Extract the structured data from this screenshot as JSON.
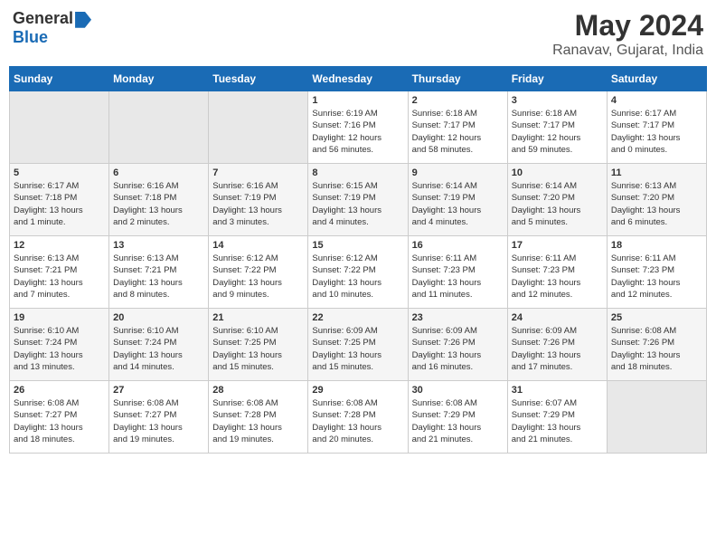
{
  "header": {
    "logo_general": "General",
    "logo_blue": "Blue",
    "month_title": "May 2024",
    "subtitle": "Ranavav, Gujarat, India"
  },
  "days_of_week": [
    "Sunday",
    "Monday",
    "Tuesday",
    "Wednesday",
    "Thursday",
    "Friday",
    "Saturday"
  ],
  "weeks": [
    [
      {
        "day": "",
        "info": ""
      },
      {
        "day": "",
        "info": ""
      },
      {
        "day": "",
        "info": ""
      },
      {
        "day": "1",
        "info": "Sunrise: 6:19 AM\nSunset: 7:16 PM\nDaylight: 12 hours\nand 56 minutes."
      },
      {
        "day": "2",
        "info": "Sunrise: 6:18 AM\nSunset: 7:17 PM\nDaylight: 12 hours\nand 58 minutes."
      },
      {
        "day": "3",
        "info": "Sunrise: 6:18 AM\nSunset: 7:17 PM\nDaylight: 12 hours\nand 59 minutes."
      },
      {
        "day": "4",
        "info": "Sunrise: 6:17 AM\nSunset: 7:17 PM\nDaylight: 13 hours\nand 0 minutes."
      }
    ],
    [
      {
        "day": "5",
        "info": "Sunrise: 6:17 AM\nSunset: 7:18 PM\nDaylight: 13 hours\nand 1 minute."
      },
      {
        "day": "6",
        "info": "Sunrise: 6:16 AM\nSunset: 7:18 PM\nDaylight: 13 hours\nand 2 minutes."
      },
      {
        "day": "7",
        "info": "Sunrise: 6:16 AM\nSunset: 7:19 PM\nDaylight: 13 hours\nand 3 minutes."
      },
      {
        "day": "8",
        "info": "Sunrise: 6:15 AM\nSunset: 7:19 PM\nDaylight: 13 hours\nand 4 minutes."
      },
      {
        "day": "9",
        "info": "Sunrise: 6:14 AM\nSunset: 7:19 PM\nDaylight: 13 hours\nand 4 minutes."
      },
      {
        "day": "10",
        "info": "Sunrise: 6:14 AM\nSunset: 7:20 PM\nDaylight: 13 hours\nand 5 minutes."
      },
      {
        "day": "11",
        "info": "Sunrise: 6:13 AM\nSunset: 7:20 PM\nDaylight: 13 hours\nand 6 minutes."
      }
    ],
    [
      {
        "day": "12",
        "info": "Sunrise: 6:13 AM\nSunset: 7:21 PM\nDaylight: 13 hours\nand 7 minutes."
      },
      {
        "day": "13",
        "info": "Sunrise: 6:13 AM\nSunset: 7:21 PM\nDaylight: 13 hours\nand 8 minutes."
      },
      {
        "day": "14",
        "info": "Sunrise: 6:12 AM\nSunset: 7:22 PM\nDaylight: 13 hours\nand 9 minutes."
      },
      {
        "day": "15",
        "info": "Sunrise: 6:12 AM\nSunset: 7:22 PM\nDaylight: 13 hours\nand 10 minutes."
      },
      {
        "day": "16",
        "info": "Sunrise: 6:11 AM\nSunset: 7:23 PM\nDaylight: 13 hours\nand 11 minutes."
      },
      {
        "day": "17",
        "info": "Sunrise: 6:11 AM\nSunset: 7:23 PM\nDaylight: 13 hours\nand 12 minutes."
      },
      {
        "day": "18",
        "info": "Sunrise: 6:11 AM\nSunset: 7:23 PM\nDaylight: 13 hours\nand 12 minutes."
      }
    ],
    [
      {
        "day": "19",
        "info": "Sunrise: 6:10 AM\nSunset: 7:24 PM\nDaylight: 13 hours\nand 13 minutes."
      },
      {
        "day": "20",
        "info": "Sunrise: 6:10 AM\nSunset: 7:24 PM\nDaylight: 13 hours\nand 14 minutes."
      },
      {
        "day": "21",
        "info": "Sunrise: 6:10 AM\nSunset: 7:25 PM\nDaylight: 13 hours\nand 15 minutes."
      },
      {
        "day": "22",
        "info": "Sunrise: 6:09 AM\nSunset: 7:25 PM\nDaylight: 13 hours\nand 15 minutes."
      },
      {
        "day": "23",
        "info": "Sunrise: 6:09 AM\nSunset: 7:26 PM\nDaylight: 13 hours\nand 16 minutes."
      },
      {
        "day": "24",
        "info": "Sunrise: 6:09 AM\nSunset: 7:26 PM\nDaylight: 13 hours\nand 17 minutes."
      },
      {
        "day": "25",
        "info": "Sunrise: 6:08 AM\nSunset: 7:26 PM\nDaylight: 13 hours\nand 18 minutes."
      }
    ],
    [
      {
        "day": "26",
        "info": "Sunrise: 6:08 AM\nSunset: 7:27 PM\nDaylight: 13 hours\nand 18 minutes."
      },
      {
        "day": "27",
        "info": "Sunrise: 6:08 AM\nSunset: 7:27 PM\nDaylight: 13 hours\nand 19 minutes."
      },
      {
        "day": "28",
        "info": "Sunrise: 6:08 AM\nSunset: 7:28 PM\nDaylight: 13 hours\nand 19 minutes."
      },
      {
        "day": "29",
        "info": "Sunrise: 6:08 AM\nSunset: 7:28 PM\nDaylight: 13 hours\nand 20 minutes."
      },
      {
        "day": "30",
        "info": "Sunrise: 6:08 AM\nSunset: 7:29 PM\nDaylight: 13 hours\nand 21 minutes."
      },
      {
        "day": "31",
        "info": "Sunrise: 6:07 AM\nSunset: 7:29 PM\nDaylight: 13 hours\nand 21 minutes."
      },
      {
        "day": "",
        "info": ""
      }
    ]
  ]
}
